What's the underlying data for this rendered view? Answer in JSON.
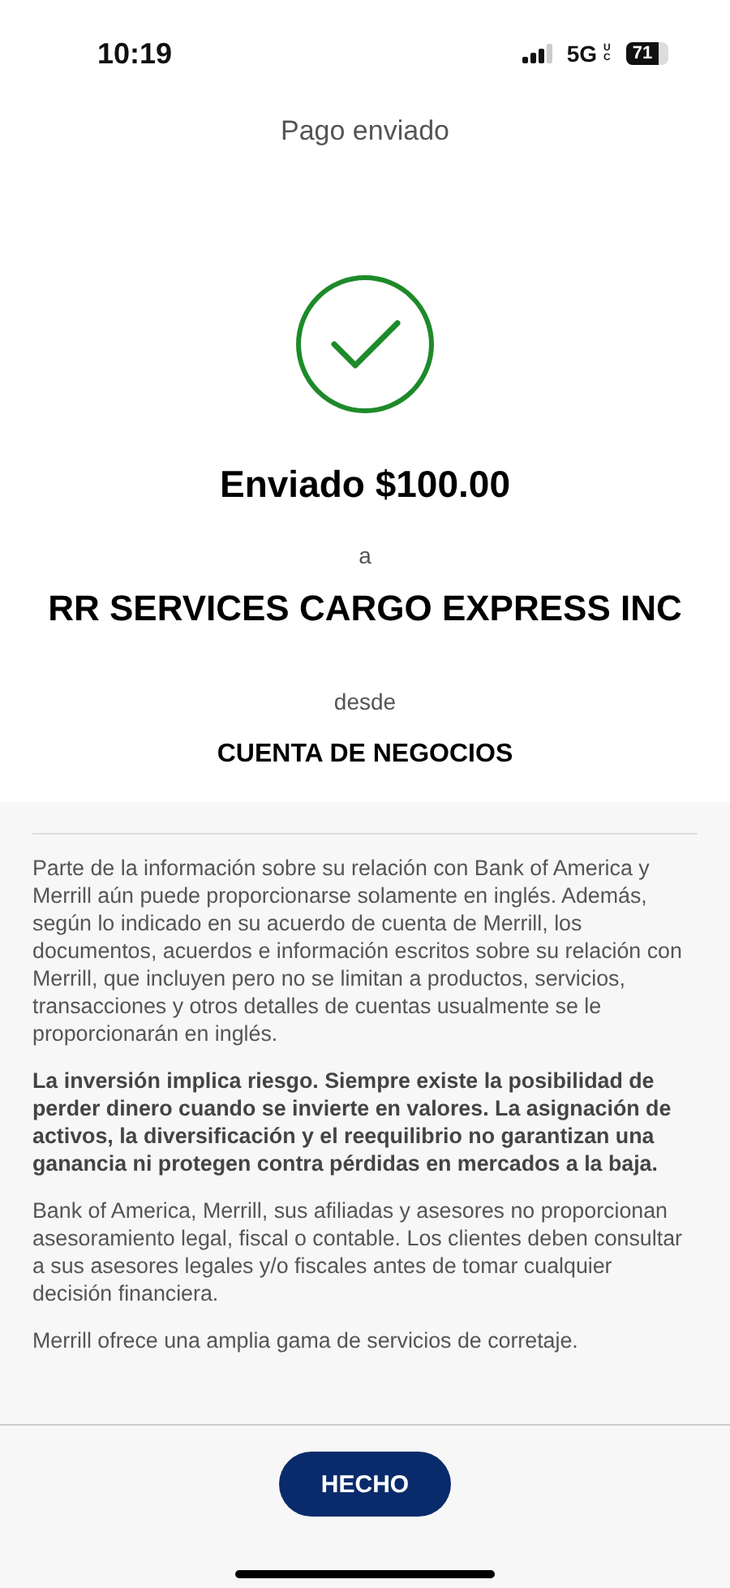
{
  "status_bar": {
    "time": "10:19",
    "network": "5G",
    "network_badge": "UC",
    "battery": "71"
  },
  "header": {
    "title": "Pago enviado"
  },
  "confirmation": {
    "amount_line": "Enviado $100.00",
    "to_label": "a",
    "recipient": "RR SERVICES CARGO EXPRESS INC",
    "from_label": "desde",
    "account": "CUENTA DE NEGOCIOS"
  },
  "disclosures": [
    {
      "kind": "normal",
      "text": "Parte de la información sobre su relación con Bank of America y Merrill aún puede proporcionarse solamente en inglés. Además, según lo indicado en su acuerdo de cuenta de Merrill, los documentos, acuerdos e información escritos sobre su relación con Merrill, que incluyen pero no se limitan a productos, servicios, transacciones y otros detalles de cuentas usualmente se le proporcionarán en inglés."
    },
    {
      "kind": "bold",
      "text": "La inversión implica riesgo. Siempre existe la posibilidad de perder dinero cuando se invierte en valores. La asignación de activos, la diversificación y el reequilibrio no garantizan una ganancia ni protegen contra pérdidas en mercados a la baja."
    },
    {
      "kind": "normal",
      "text": "Bank of America, Merrill, sus afiliadas y asesores no proporcionan asesoramiento legal, fiscal o contable. Los clientes deben consultar a sus asesores legales y/o fiscales antes de tomar cualquier decisión financiera."
    },
    {
      "kind": "normal",
      "text": "Merrill ofrece una amplia gama de servicios de corretaje."
    }
  ],
  "footer": {
    "button": "HECHO"
  }
}
